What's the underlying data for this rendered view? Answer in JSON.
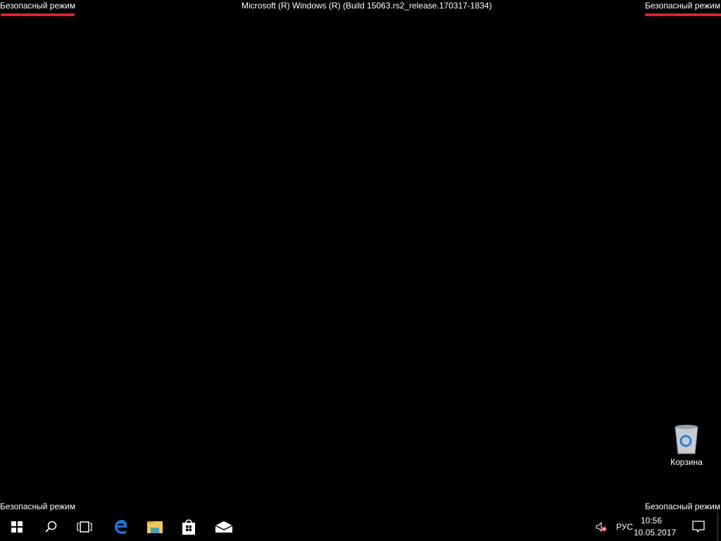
{
  "watermarks": {
    "safe_mode": "Безопасный режим",
    "build": "Microsoft (R) Windows (R) (Build 15063.rs2_release.170317-1834)"
  },
  "colors": {
    "underline": "#e0202a",
    "edge": "#1e73d6"
  },
  "desktop": {
    "recycle_bin_label": "Корзина"
  },
  "taskbar": {
    "icons": [
      "windows-start-icon",
      "search-icon",
      "task-view-icon",
      "edge-icon",
      "file-explorer-icon",
      "store-icon",
      "mail-icon"
    ],
    "tray": {
      "language": "РУС",
      "time": "10:56",
      "date": "10.05.2017"
    }
  }
}
